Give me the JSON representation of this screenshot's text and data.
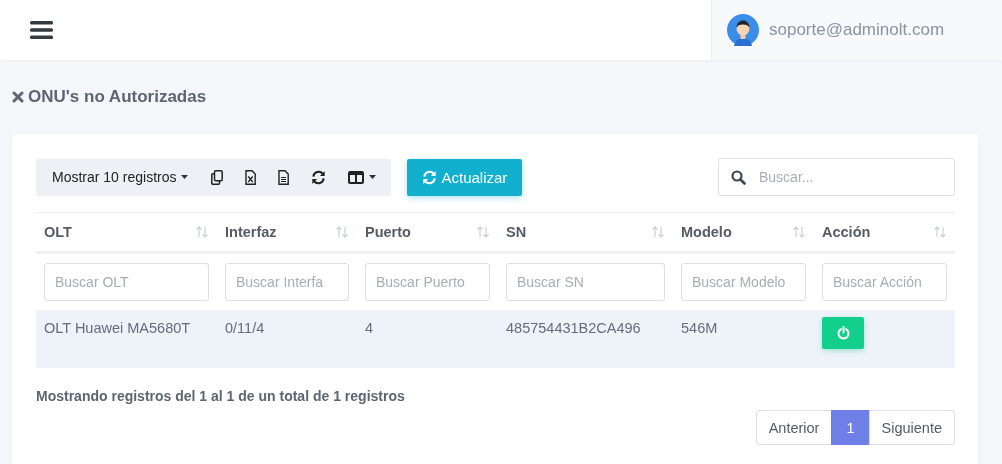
{
  "header": {
    "user_email": "soporte@adminolt.com"
  },
  "page": {
    "title": "ONU's no Autorizadas"
  },
  "toolbar": {
    "length_menu": "Mostrar 10 registros",
    "refresh_button": "Actualizar",
    "search_placeholder": "Buscar..."
  },
  "table": {
    "columns": [
      {
        "label": "OLT",
        "filter_placeholder": "Buscar OLT"
      },
      {
        "label": "Interfaz",
        "filter_placeholder": "Buscar Interfa"
      },
      {
        "label": "Puerto",
        "filter_placeholder": "Buscar Puerto"
      },
      {
        "label": "SN",
        "filter_placeholder": "Buscar SN"
      },
      {
        "label": "Modelo",
        "filter_placeholder": "Buscar Modelo"
      },
      {
        "label": "Acción",
        "filter_placeholder": "Buscar Acción"
      }
    ],
    "rows": [
      {
        "cells": [
          "OLT Huawei MA5680T",
          "0/11/4",
          "4",
          "485754431B2CA496",
          "546M"
        ]
      }
    ]
  },
  "info": "Mostrando registros del 1 al 1 de un total de 1 registros",
  "pagination": [
    {
      "label": "Anterior",
      "selected": false
    },
    {
      "label": "1",
      "selected": true
    },
    {
      "label": "Siguiente",
      "selected": false
    }
  ]
}
